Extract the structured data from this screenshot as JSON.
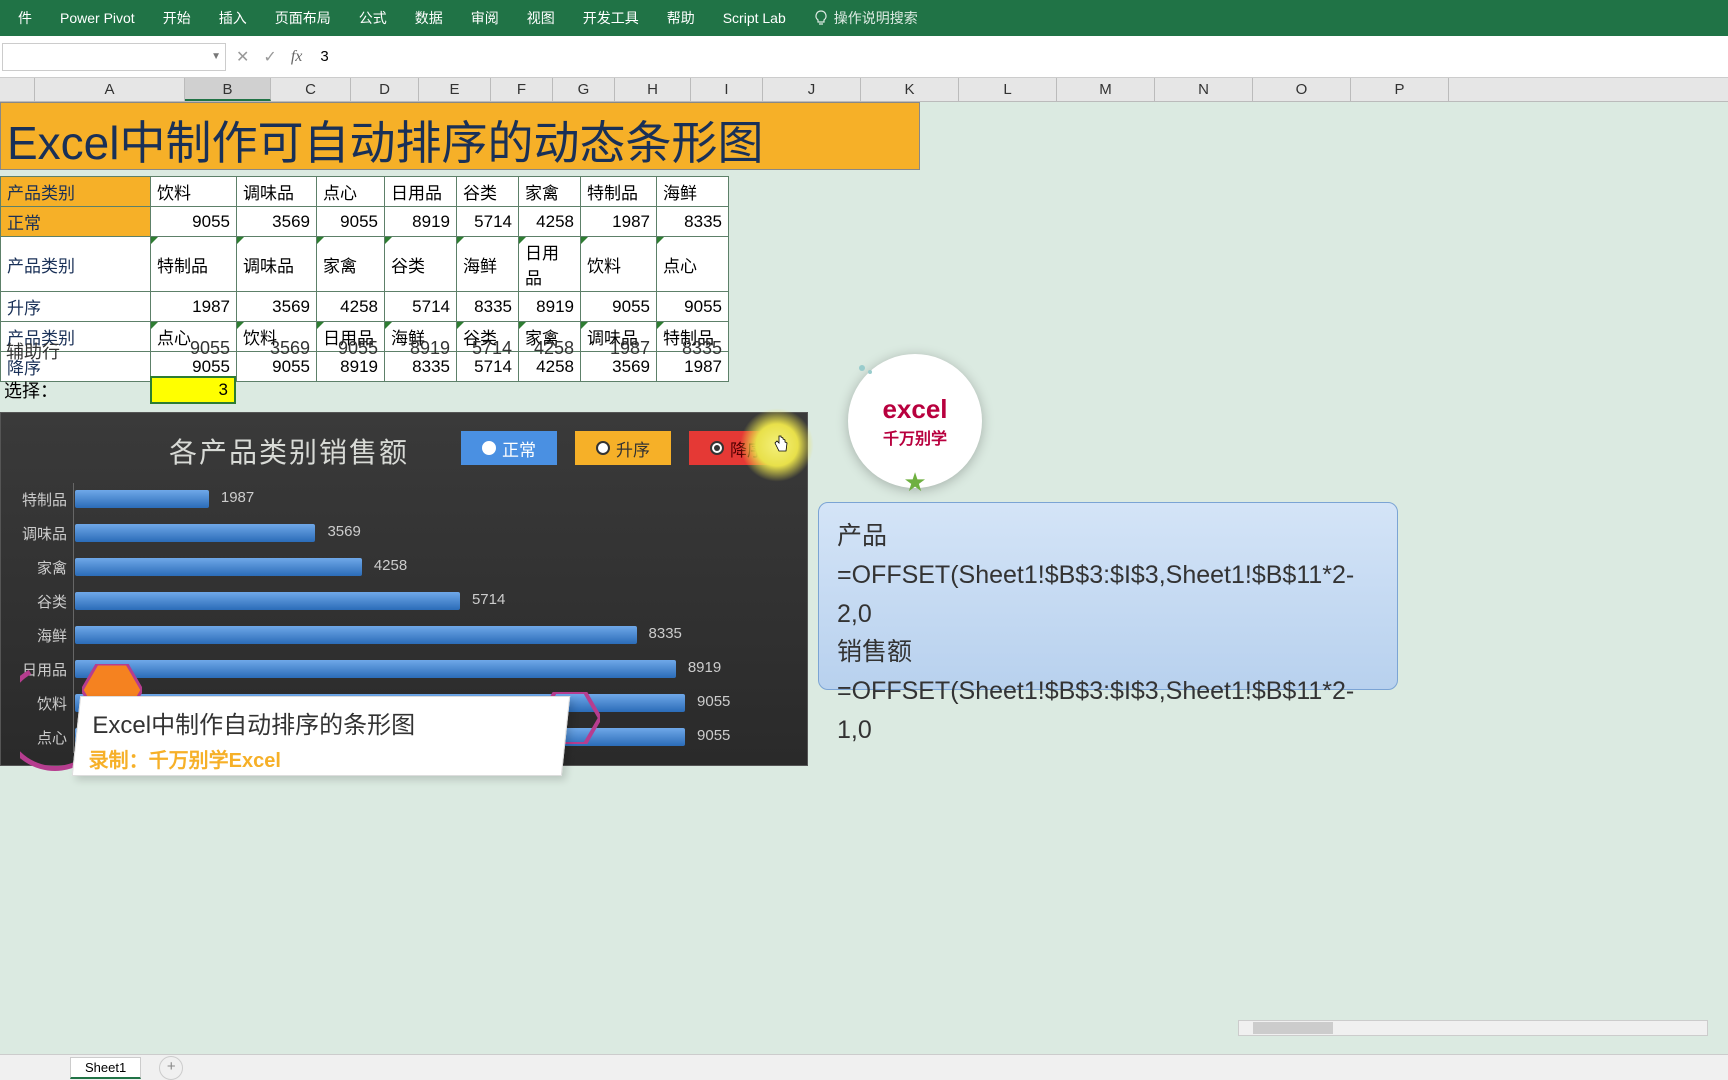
{
  "ribbon": {
    "tabs": [
      "件",
      "Power Pivot",
      "开始",
      "插入",
      "页面布局",
      "公式",
      "数据",
      "审阅",
      "视图",
      "开发工具",
      "帮助",
      "Script Lab"
    ],
    "search_placeholder": "操作说明搜索"
  },
  "formula_bar": {
    "name_box": "",
    "value": "3"
  },
  "columns": [
    "A",
    "B",
    "C",
    "D",
    "E",
    "F",
    "G",
    "H",
    "I",
    "J",
    "K",
    "L",
    "M",
    "N",
    "O",
    "P"
  ],
  "selected_col": "B",
  "title": "Excel中制作可自动排序的动态条形图",
  "table": {
    "rows": [
      {
        "lbl": "产品类别",
        "vals": [
          "饮料",
          "调味品",
          "点心",
          "日用品",
          "谷类",
          "家禽",
          "特制品",
          "海鲜"
        ],
        "yellow": true
      },
      {
        "lbl": "正常",
        "vals": [
          "9055",
          "3569",
          "9055",
          "8919",
          "5714",
          "4258",
          "1987",
          "8335"
        ],
        "yellow": true,
        "num": true
      },
      {
        "lbl": "产品类别",
        "vals": [
          "特制品",
          "调味品",
          "家禽",
          "谷类",
          "海鲜",
          "日用品",
          "饮料",
          "点心"
        ],
        "tri": true
      },
      {
        "lbl": "升序",
        "vals": [
          "1987",
          "3569",
          "4258",
          "5714",
          "8335",
          "8919",
          "9055",
          "9055"
        ],
        "num": true
      },
      {
        "lbl": "产品类别",
        "vals": [
          "点心",
          "饮料",
          "日用品",
          "海鲜",
          "谷类",
          "家禽",
          "调味品",
          "特制品"
        ],
        "tri": true
      },
      {
        "lbl": "降序",
        "vals": [
          "9055",
          "9055",
          "8919",
          "8335",
          "5714",
          "4258",
          "3569",
          "1987"
        ],
        "num": true
      }
    ],
    "aux_label": "辅助行",
    "aux_vals": [
      "9055",
      "3569",
      "9055",
      "8919",
      "5714",
      "4258",
      "1987",
      "8335"
    ]
  },
  "choose": {
    "label": "选择：",
    "value": "3"
  },
  "chart_data": {
    "type": "bar",
    "title": "各产品类别销售额",
    "buttons": [
      {
        "label": "正常",
        "active": false,
        "cls": "b1"
      },
      {
        "label": "升序",
        "active": false,
        "cls": "b2"
      },
      {
        "label": "降序",
        "active": true,
        "cls": "b3"
      }
    ],
    "categories": [
      "特制品",
      "调味品",
      "家禽",
      "谷类",
      "海鲜",
      "日用品",
      "饮料",
      "点心"
    ],
    "values": [
      1987,
      3569,
      4258,
      5714,
      8335,
      8919,
      9055,
      9055
    ],
    "xlim": [
      0,
      9500
    ]
  },
  "caption": {
    "line1": "Excel中制作自动排序的条形图",
    "line2": "录制：千万别学Excel"
  },
  "logo": {
    "t1": "excel",
    "t2": "千万别学"
  },
  "formula_box": {
    "l1": "产品",
    "l2": "=OFFSET(Sheet1!$B$3:$I$3,Sheet1!$B$11*2-2,0",
    "l3": "销售额",
    "l4": "=OFFSET(Sheet1!$B$3:$I$3,Sheet1!$B$11*2-1,0"
  },
  "sheet_tabs": {
    "active": "Sheet1"
  }
}
